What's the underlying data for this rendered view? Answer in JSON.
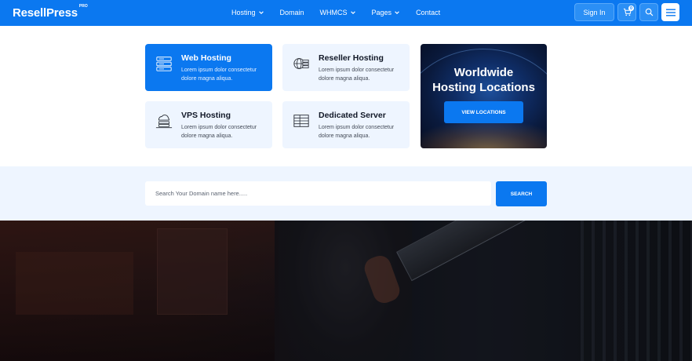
{
  "brand": {
    "name": "ResellPress",
    "badge": "PRO"
  },
  "nav": {
    "items": [
      {
        "label": "Hosting",
        "has_dropdown": true
      },
      {
        "label": "Domain",
        "has_dropdown": false
      },
      {
        "label": "WHMCS",
        "has_dropdown": true
      },
      {
        "label": "Pages",
        "has_dropdown": true
      },
      {
        "label": "Contact",
        "has_dropdown": false
      }
    ],
    "signin_label": "Sign In",
    "cart_count": "0"
  },
  "services": [
    {
      "title": "Web Hosting",
      "description": "Lorem ipsum dolor consectetur dolore magna aliqua.",
      "icon": "server-stack-icon",
      "active": true
    },
    {
      "title": "Reseller Hosting",
      "description": "Lorem ipsum dolor consectetur dolore magna aliqua.",
      "icon": "globe-server-icon",
      "active": false
    },
    {
      "title": "VPS Hosting",
      "description": "Lorem ipsum dolor consectetur dolore magna aliqua.",
      "icon": "cloud-server-icon",
      "active": false
    },
    {
      "title": "Dedicated Server",
      "description": "Lorem ipsum dolor consectetur dolore magna aliqua.",
      "icon": "dedicated-server-icon",
      "active": false
    }
  ],
  "promo": {
    "title_line1": "Worldwide",
    "title_line2": "Hosting Locations",
    "button_label": "VIEW LOCATIONS"
  },
  "domain_search": {
    "placeholder": "Search Your Domain name here.....",
    "value": "",
    "button_label": "SEARCH"
  },
  "colors": {
    "primary": "#0b78f0",
    "card_bg": "#eef5ff",
    "text_dark": "#111827"
  }
}
